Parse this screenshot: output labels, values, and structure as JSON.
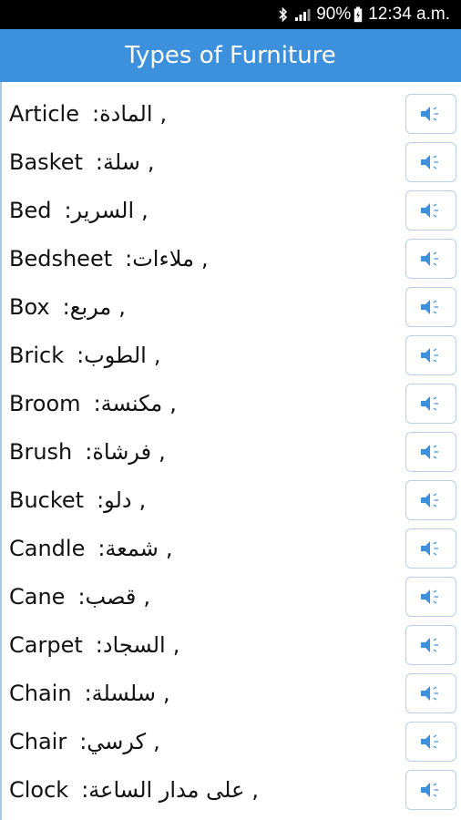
{
  "status_bar": {
    "bluetooth_icon": "bluetooth-icon",
    "signal_icon": "signal-icon",
    "battery_percent": "90%",
    "battery_icon": "battery-icon",
    "time": "12:34 a.m."
  },
  "app_bar": {
    "title": "Types of Furniture"
  },
  "colors": {
    "app_bar": "#3d91dc",
    "speaker_icon": "#3d91dc",
    "button_border": "#b8d0ea"
  },
  "items": [
    {
      "english": "Article",
      "arabic": "المادة:",
      "separator": ","
    },
    {
      "english": "Basket",
      "arabic": "سلة:",
      "separator": ","
    },
    {
      "english": "Bed",
      "arabic": "السرير:",
      "separator": ","
    },
    {
      "english": "Bedsheet",
      "arabic": "ملاءات:",
      "separator": ","
    },
    {
      "english": "Box",
      "arabic": "مربع:",
      "separator": ","
    },
    {
      "english": "Brick",
      "arabic": "الطوب:",
      "separator": ","
    },
    {
      "english": "Broom",
      "arabic": "مكنسة:",
      "separator": ","
    },
    {
      "english": "Brush",
      "arabic": "فرشاة:",
      "separator": ","
    },
    {
      "english": "Bucket",
      "arabic": "دلو:",
      "separator": ","
    },
    {
      "english": "Candle",
      "arabic": "شمعة:",
      "separator": ","
    },
    {
      "english": "Cane",
      "arabic": "قصب:",
      "separator": ","
    },
    {
      "english": "Carpet",
      "arabic": "السجاد:",
      "separator": ","
    },
    {
      "english": "Chain",
      "arabic": "سلسلة:",
      "separator": ","
    },
    {
      "english": "Chair",
      "arabic": "كرسي:",
      "separator": ","
    },
    {
      "english": "Clock",
      "arabic": "على مدار الساعة:",
      "separator": ","
    }
  ]
}
